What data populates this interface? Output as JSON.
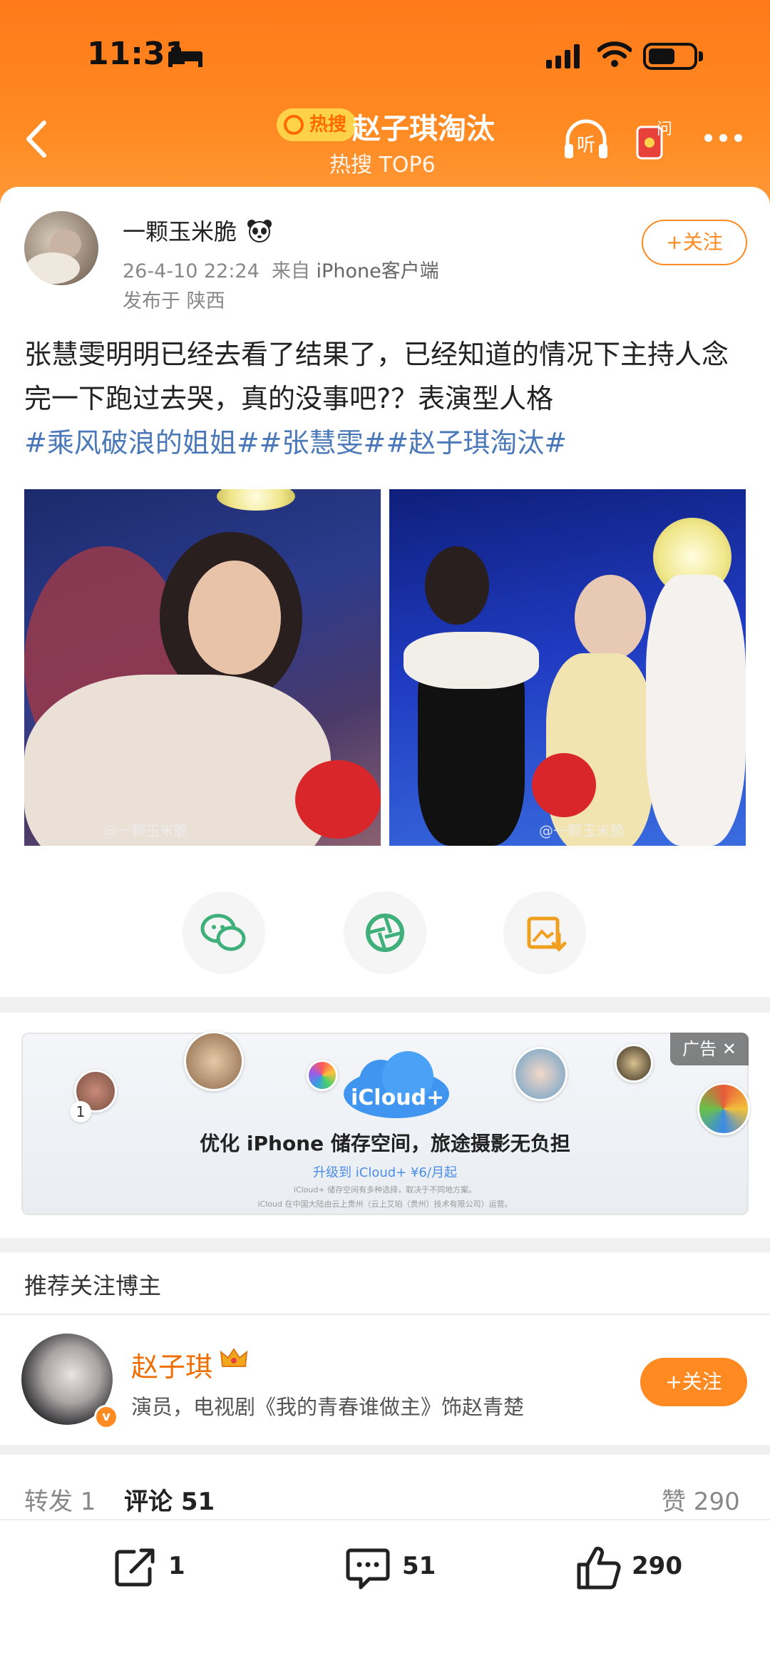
{
  "status": {
    "time": "11:31"
  },
  "header": {
    "badge": "热搜",
    "topic": "赵子琪淘汰",
    "subtitle": "热搜 TOP6",
    "listen_label": "听",
    "ask_label": "问"
  },
  "post": {
    "author": "一颗玉米脆",
    "timestamp": "26-4-10 22:24",
    "source_prefix": "来自",
    "source": "iPhone客户端",
    "location": "发布于 陕西",
    "follow_label": "+关注",
    "text": "张慧雯明明已经去看了结果了，已经知道的情况下主持人念完一下跑过去哭，真的没事吧?？表演型人格",
    "hashtags": "#乘风破浪的姐姐##张慧雯##赵子琪淘汰#",
    "watermark_1": "@一颗玉米脆",
    "watermark_2": "@一颗玉米脆"
  },
  "ad": {
    "tag": "广告",
    "product": "iCloud+",
    "headline": "优化 iPhone 储存空间，旅途摄影无负担",
    "sub": "升级到 iCloud+ ¥6/月起",
    "fine_1": "iCloud+ 储存空间有多种选择，取决于不同地方案。",
    "fine_2": "iCloud 在中国大陆由云上贵州（云上艾珀（贵州）技术有限公司）运营。",
    "rank": "1"
  },
  "recommend": {
    "title": "推荐关注博主",
    "name": "赵子琪",
    "desc": "演员，电视剧《我的青春谁做主》饰赵青楚",
    "follow_label": "+关注"
  },
  "stats": {
    "repost": "转发 1",
    "comment": "评论 51",
    "like": "赞 290"
  },
  "actions": {
    "repost_count": "1",
    "comment_count": "51",
    "like_count": "290"
  },
  "colors": {
    "brand_orange": "#ff8a22",
    "hashtag_blue": "#4a78b8"
  }
}
